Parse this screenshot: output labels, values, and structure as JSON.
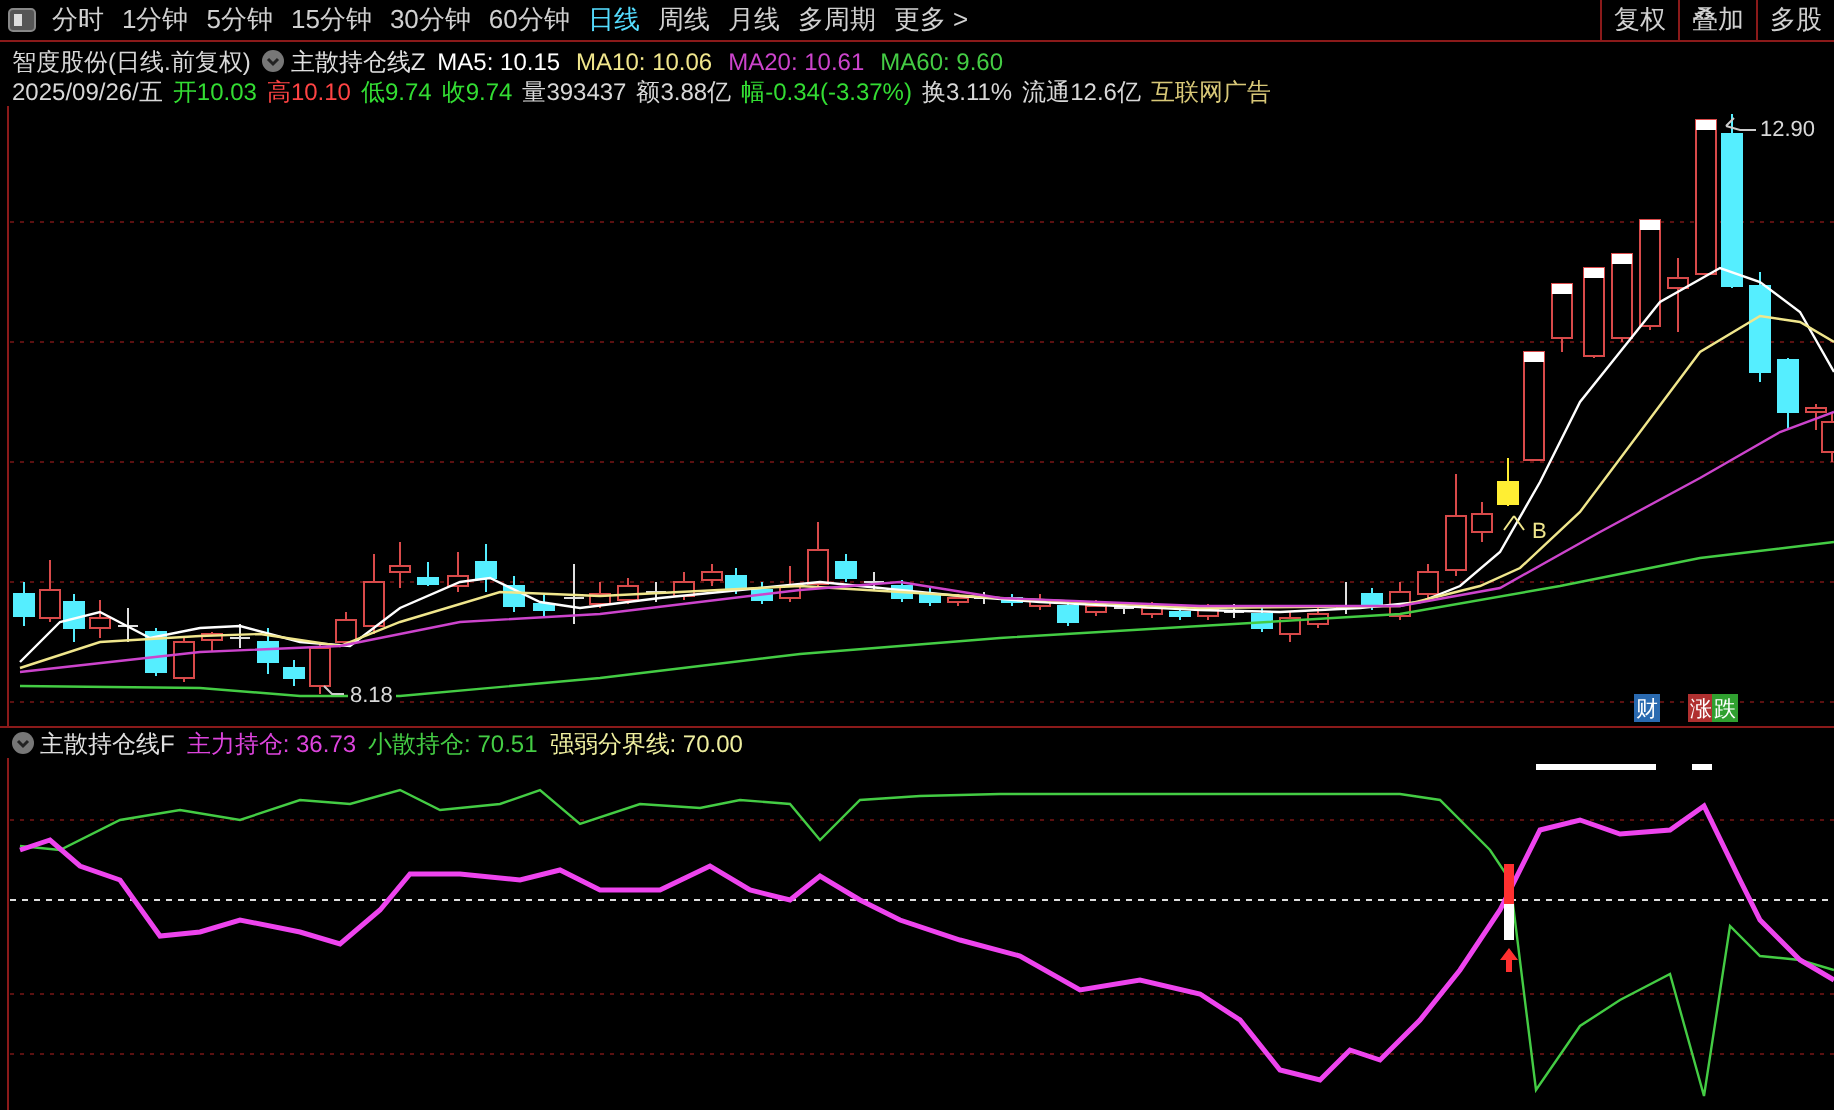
{
  "toolbar": {
    "periods": [
      {
        "label": "分时",
        "selected": false
      },
      {
        "label": "1分钟",
        "selected": false
      },
      {
        "label": "5分钟",
        "selected": false
      },
      {
        "label": "15分钟",
        "selected": false
      },
      {
        "label": "30分钟",
        "selected": false
      },
      {
        "label": "60分钟",
        "selected": false
      },
      {
        "label": "日线",
        "selected": true
      },
      {
        "label": "周线",
        "selected": false
      },
      {
        "label": "月线",
        "selected": false
      },
      {
        "label": "多周期",
        "selected": false
      }
    ],
    "more": "更多 >",
    "right_buttons": [
      "复权",
      "叠加",
      "多股"
    ]
  },
  "header": {
    "stock": "智度股份(日线.前复权)",
    "indicator": "主散持仓线Z",
    "ma": [
      {
        "text": "MA5: 10.15",
        "color": "#ffffff"
      },
      {
        "text": "MA10: 10.06",
        "color": "#f0e68c"
      },
      {
        "text": "MA20: 10.61",
        "color": "#cc44cc"
      },
      {
        "text": "MA60: 9.60",
        "color": "#44cc44"
      }
    ],
    "quote": [
      {
        "text": "2025/09/26/五",
        "color": "#d8d8d8"
      },
      {
        "text": "开10.03",
        "color": "#33dd33"
      },
      {
        "text": "高10.10",
        "color": "#ff4444"
      },
      {
        "text": "低9.74",
        "color": "#33dd33"
      },
      {
        "text": "收9.74",
        "color": "#33dd33"
      },
      {
        "text": "量393437",
        "color": "#d8d8d8"
      },
      {
        "text": "额3.88亿",
        "color": "#d8d8d8"
      },
      {
        "text": "幅-0.34(-3.37%)",
        "color": "#33dd33"
      },
      {
        "text": "换3.11%",
        "color": "#d8d8d8"
      },
      {
        "text": "流通12.6亿",
        "color": "#d8d8d8"
      },
      {
        "text": "互联网广告",
        "color": "#d8c878"
      }
    ]
  },
  "main_chart": {
    "high_label": "12.90",
    "low_label": "8.18",
    "signal_label": "B",
    "tags": [
      {
        "text": "财",
        "color": "#2a6ab0"
      },
      {
        "text": "涨",
        "color": "#b03030"
      },
      {
        "text": "跌",
        "color": "#30a030"
      }
    ]
  },
  "indicator": {
    "name": "主散持仓线F",
    "values": [
      {
        "text": "主力持仓: 36.73",
        "color": "#dd44dd"
      },
      {
        "text": "小散持仓: 70.51",
        "color": "#44cc44"
      },
      {
        "text": "强弱分界线: 70.00",
        "color": "#f0f0a0"
      }
    ]
  }
}
